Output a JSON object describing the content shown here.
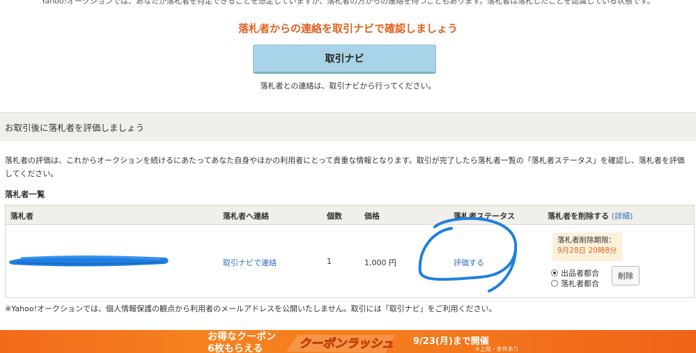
{
  "top": {
    "note": "Yahoo!オークションでは、あなたが落札者を特定できることを想定していますが、落札者の方からの連絡を待つこともあります。落札者は落札したことを認識している状態です。"
  },
  "contact": {
    "heading": "落札者からの連絡を取引ナビで確認しましょう",
    "navi_button": "取引ナビ",
    "navi_sub": "落札者との連絡は、取引ナビから行ってください。"
  },
  "evaluation": {
    "band_title": "お取引後に落札者を評価しましょう",
    "description": "落札者の評価は、これからオークションを続けるにあたってあなた自身やほかの利用者にとって貴重な情報となります。取引が完了したら落札者一覧の「落札者ステータス」を確認し、落札者を評価してください。"
  },
  "winners": {
    "title": "落札者一覧",
    "headers": {
      "winner": "落札者",
      "contact": "落札者へ連絡",
      "quantity": "個数",
      "price": "価格",
      "status": "落札者ステータス",
      "delete": "落札者を削除する",
      "detail": "(詳細)"
    },
    "rows": [
      {
        "contact_link": "取引ナビで連絡",
        "quantity": "1",
        "price": "1,000 円",
        "status_link": "評価する",
        "deadline_label": "落札者削除期限：",
        "deadline_date": "9月28日 20時8分",
        "reason_seller": "出品者都合",
        "reason_winner": "落札者都合",
        "delete_button": "削除"
      }
    ]
  },
  "privacy": {
    "note": "※Yahoo!オークションでは、個人情報保護の観点から利用者のメールアドレスを公開いたしません。取引には「取引ナビ」をご利用ください。"
  },
  "banner": {
    "line1": "お得なクーポン",
    "line2": "6枚もらえる",
    "logo_text": "クーポンラッシュ",
    "date": "9/23(月)まで開催",
    "condition": "※上限・条件あり"
  },
  "colors": {
    "accent_orange": "#e0621f",
    "link_blue": "#2a6fbd",
    "navi_button": "#a9d3e6",
    "band_bg": "#f0efe9",
    "scribble_blue": "#1f7fe0"
  }
}
